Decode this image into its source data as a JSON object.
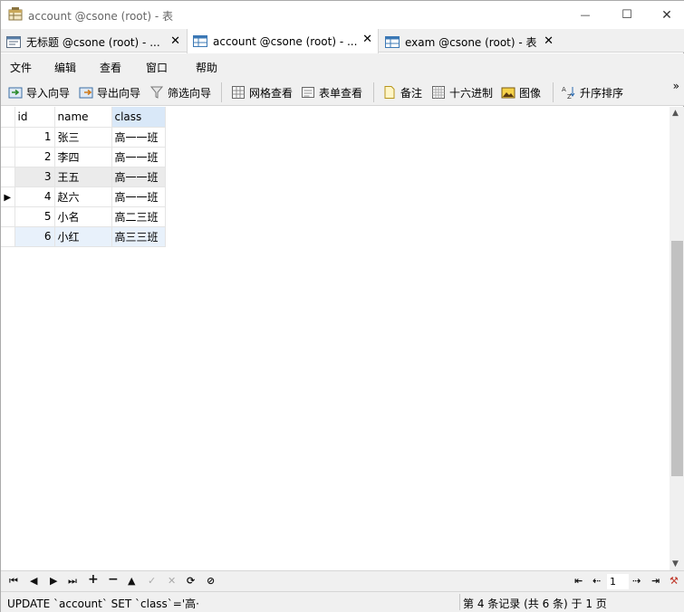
{
  "window": {
    "title": "account @csone (root) - 表",
    "controls": {
      "minimize": "—",
      "maximize": "☐",
      "close": "✕"
    }
  },
  "tabs": [
    {
      "label": "无标题 @csone (root) - ...",
      "close": "✕",
      "icon": "query-icon",
      "active": false
    },
    {
      "label": "account @csone (root) - ...",
      "close": "✕",
      "icon": "table-icon",
      "active": true
    },
    {
      "label": "exam @csone (root) - 表",
      "close": "✕",
      "icon": "table-icon",
      "active": false
    }
  ],
  "menu": [
    "文件",
    "编辑",
    "查看",
    "窗口",
    "帮助"
  ],
  "toolbar": {
    "import_wizard": "导入向导",
    "export_wizard": "导出向导",
    "filter_wizard": "筛选向导",
    "grid_view": "网格查看",
    "form_view": "表单查看",
    "memo": "备注",
    "hex": "十六进制",
    "image": "图像",
    "sort_asc": "升序排序",
    "more": "»"
  },
  "grid": {
    "columns": [
      "id",
      "name",
      "class"
    ],
    "selected_column": "class",
    "current_row": 4,
    "rows": [
      {
        "id": "1",
        "name": "张三",
        "class": "高一一班"
      },
      {
        "id": "2",
        "name": "李四",
        "class": "高一一班"
      },
      {
        "id": "3",
        "name": "王五",
        "class": "高一一班"
      },
      {
        "id": "4",
        "name": "赵六",
        "class": "高一一班"
      },
      {
        "id": "5",
        "name": "小名",
        "class": "高二三班"
      },
      {
        "id": "6",
        "name": "小红",
        "class": "高三三班"
      }
    ],
    "row_marker": "▶"
  },
  "navbar": {
    "first": "⏮",
    "prev": "◀",
    "next": "▶",
    "last": "⏭",
    "add": "+",
    "delete": "−",
    "up": "▲",
    "apply": "✓",
    "discard": "✕",
    "refresh": "⟳",
    "stop": "⊘",
    "page_first": "⇤",
    "page_prev": "⇠",
    "page_next": "⇢",
    "page_last": "⇥",
    "page_value": "1",
    "settings": "⚒"
  },
  "status": {
    "sql": "UPDATE `account` SET `class`='高·",
    "record": "第 4 条记录 (共 6 条) 于 1 页"
  }
}
